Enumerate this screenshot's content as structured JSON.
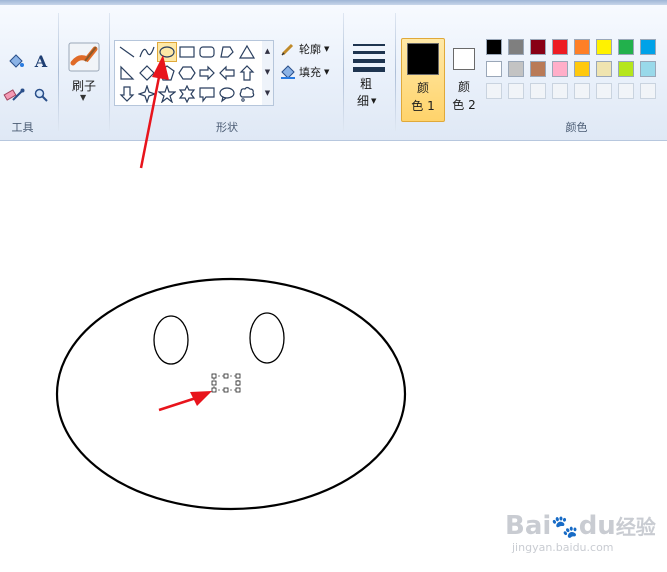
{
  "ribbon": {
    "groups": {
      "tools_label": "工具",
      "shapes_label": "形状",
      "colors_label": "颜色"
    },
    "brushes_label": "刷子",
    "outline_label": "轮廓",
    "fill_label": "填充",
    "size_label_1": "粗",
    "size_label_2": "细",
    "color1_label_1": "颜",
    "color1_label_2": "色 1",
    "color2_label_1": "颜",
    "color2_label_2": "色 2",
    "palette_row1": [
      "#000000",
      "#7f7f7f",
      "#880015",
      "#ed1c24",
      "#ff7f27",
      "#fff200",
      "#22b14c",
      "#00a2e8"
    ],
    "palette_row2": [
      "#ffffff",
      "#c3c3c3",
      "#b97a57",
      "#ffaec9",
      "#ffc90e",
      "#efe4b0",
      "#b5e61d",
      "#99d9ea"
    ],
    "color1_value": "#000000",
    "color2_value": "#ffffff",
    "selected_shape": "oval",
    "icons": [
      "fill-bucket-icon",
      "text-icon",
      "eraser-icon",
      "color-picker-icon",
      "magnifier-icon",
      "brush-icon",
      "outline-pen-icon",
      "fill-icon"
    ]
  },
  "watermark": {
    "brand_a": "Bai",
    "brand_b": "du",
    "brand_c": "经验",
    "url": "jingyan.baidu.com"
  },
  "annotations": {
    "arrow_color": "#e8141c"
  }
}
